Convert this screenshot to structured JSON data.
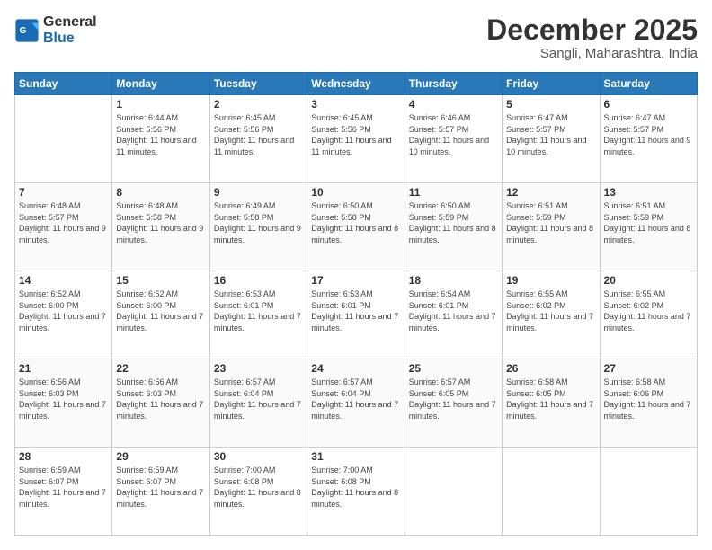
{
  "logo": {
    "text_general": "General",
    "text_blue": "Blue"
  },
  "header": {
    "month": "December 2025",
    "location": "Sangli, Maharashtra, India"
  },
  "weekdays": [
    "Sunday",
    "Monday",
    "Tuesday",
    "Wednesday",
    "Thursday",
    "Friday",
    "Saturday"
  ],
  "weeks": [
    [
      {
        "day": "",
        "sunrise": "",
        "sunset": "",
        "daylight": ""
      },
      {
        "day": "1",
        "sunrise": "Sunrise: 6:44 AM",
        "sunset": "Sunset: 5:56 PM",
        "daylight": "Daylight: 11 hours and 11 minutes."
      },
      {
        "day": "2",
        "sunrise": "Sunrise: 6:45 AM",
        "sunset": "Sunset: 5:56 PM",
        "daylight": "Daylight: 11 hours and 11 minutes."
      },
      {
        "day": "3",
        "sunrise": "Sunrise: 6:45 AM",
        "sunset": "Sunset: 5:56 PM",
        "daylight": "Daylight: 11 hours and 11 minutes."
      },
      {
        "day": "4",
        "sunrise": "Sunrise: 6:46 AM",
        "sunset": "Sunset: 5:57 PM",
        "daylight": "Daylight: 11 hours and 10 minutes."
      },
      {
        "day": "5",
        "sunrise": "Sunrise: 6:47 AM",
        "sunset": "Sunset: 5:57 PM",
        "daylight": "Daylight: 11 hours and 10 minutes."
      },
      {
        "day": "6",
        "sunrise": "Sunrise: 6:47 AM",
        "sunset": "Sunset: 5:57 PM",
        "daylight": "Daylight: 11 hours and 9 minutes."
      }
    ],
    [
      {
        "day": "7",
        "sunrise": "Sunrise: 6:48 AM",
        "sunset": "Sunset: 5:57 PM",
        "daylight": "Daylight: 11 hours and 9 minutes."
      },
      {
        "day": "8",
        "sunrise": "Sunrise: 6:48 AM",
        "sunset": "Sunset: 5:58 PM",
        "daylight": "Daylight: 11 hours and 9 minutes."
      },
      {
        "day": "9",
        "sunrise": "Sunrise: 6:49 AM",
        "sunset": "Sunset: 5:58 PM",
        "daylight": "Daylight: 11 hours and 9 minutes."
      },
      {
        "day": "10",
        "sunrise": "Sunrise: 6:50 AM",
        "sunset": "Sunset: 5:58 PM",
        "daylight": "Daylight: 11 hours and 8 minutes."
      },
      {
        "day": "11",
        "sunrise": "Sunrise: 6:50 AM",
        "sunset": "Sunset: 5:59 PM",
        "daylight": "Daylight: 11 hours and 8 minutes."
      },
      {
        "day": "12",
        "sunrise": "Sunrise: 6:51 AM",
        "sunset": "Sunset: 5:59 PM",
        "daylight": "Daylight: 11 hours and 8 minutes."
      },
      {
        "day": "13",
        "sunrise": "Sunrise: 6:51 AM",
        "sunset": "Sunset: 5:59 PM",
        "daylight": "Daylight: 11 hours and 8 minutes."
      }
    ],
    [
      {
        "day": "14",
        "sunrise": "Sunrise: 6:52 AM",
        "sunset": "Sunset: 6:00 PM",
        "daylight": "Daylight: 11 hours and 7 minutes."
      },
      {
        "day": "15",
        "sunrise": "Sunrise: 6:52 AM",
        "sunset": "Sunset: 6:00 PM",
        "daylight": "Daylight: 11 hours and 7 minutes."
      },
      {
        "day": "16",
        "sunrise": "Sunrise: 6:53 AM",
        "sunset": "Sunset: 6:01 PM",
        "daylight": "Daylight: 11 hours and 7 minutes."
      },
      {
        "day": "17",
        "sunrise": "Sunrise: 6:53 AM",
        "sunset": "Sunset: 6:01 PM",
        "daylight": "Daylight: 11 hours and 7 minutes."
      },
      {
        "day": "18",
        "sunrise": "Sunrise: 6:54 AM",
        "sunset": "Sunset: 6:01 PM",
        "daylight": "Daylight: 11 hours and 7 minutes."
      },
      {
        "day": "19",
        "sunrise": "Sunrise: 6:55 AM",
        "sunset": "Sunset: 6:02 PM",
        "daylight": "Daylight: 11 hours and 7 minutes."
      },
      {
        "day": "20",
        "sunrise": "Sunrise: 6:55 AM",
        "sunset": "Sunset: 6:02 PM",
        "daylight": "Daylight: 11 hours and 7 minutes."
      }
    ],
    [
      {
        "day": "21",
        "sunrise": "Sunrise: 6:56 AM",
        "sunset": "Sunset: 6:03 PM",
        "daylight": "Daylight: 11 hours and 7 minutes."
      },
      {
        "day": "22",
        "sunrise": "Sunrise: 6:56 AM",
        "sunset": "Sunset: 6:03 PM",
        "daylight": "Daylight: 11 hours and 7 minutes."
      },
      {
        "day": "23",
        "sunrise": "Sunrise: 6:57 AM",
        "sunset": "Sunset: 6:04 PM",
        "daylight": "Daylight: 11 hours and 7 minutes."
      },
      {
        "day": "24",
        "sunrise": "Sunrise: 6:57 AM",
        "sunset": "Sunset: 6:04 PM",
        "daylight": "Daylight: 11 hours and 7 minutes."
      },
      {
        "day": "25",
        "sunrise": "Sunrise: 6:57 AM",
        "sunset": "Sunset: 6:05 PM",
        "daylight": "Daylight: 11 hours and 7 minutes."
      },
      {
        "day": "26",
        "sunrise": "Sunrise: 6:58 AM",
        "sunset": "Sunset: 6:05 PM",
        "daylight": "Daylight: 11 hours and 7 minutes."
      },
      {
        "day": "27",
        "sunrise": "Sunrise: 6:58 AM",
        "sunset": "Sunset: 6:06 PM",
        "daylight": "Daylight: 11 hours and 7 minutes."
      }
    ],
    [
      {
        "day": "28",
        "sunrise": "Sunrise: 6:59 AM",
        "sunset": "Sunset: 6:07 PM",
        "daylight": "Daylight: 11 hours and 7 minutes."
      },
      {
        "day": "29",
        "sunrise": "Sunrise: 6:59 AM",
        "sunset": "Sunset: 6:07 PM",
        "daylight": "Daylight: 11 hours and 7 minutes."
      },
      {
        "day": "30",
        "sunrise": "Sunrise: 7:00 AM",
        "sunset": "Sunset: 6:08 PM",
        "daylight": "Daylight: 11 hours and 8 minutes."
      },
      {
        "day": "31",
        "sunrise": "Sunrise: 7:00 AM",
        "sunset": "Sunset: 6:08 PM",
        "daylight": "Daylight: 11 hours and 8 minutes."
      },
      {
        "day": "",
        "sunrise": "",
        "sunset": "",
        "daylight": ""
      },
      {
        "day": "",
        "sunrise": "",
        "sunset": "",
        "daylight": ""
      },
      {
        "day": "",
        "sunrise": "",
        "sunset": "",
        "daylight": ""
      }
    ]
  ]
}
